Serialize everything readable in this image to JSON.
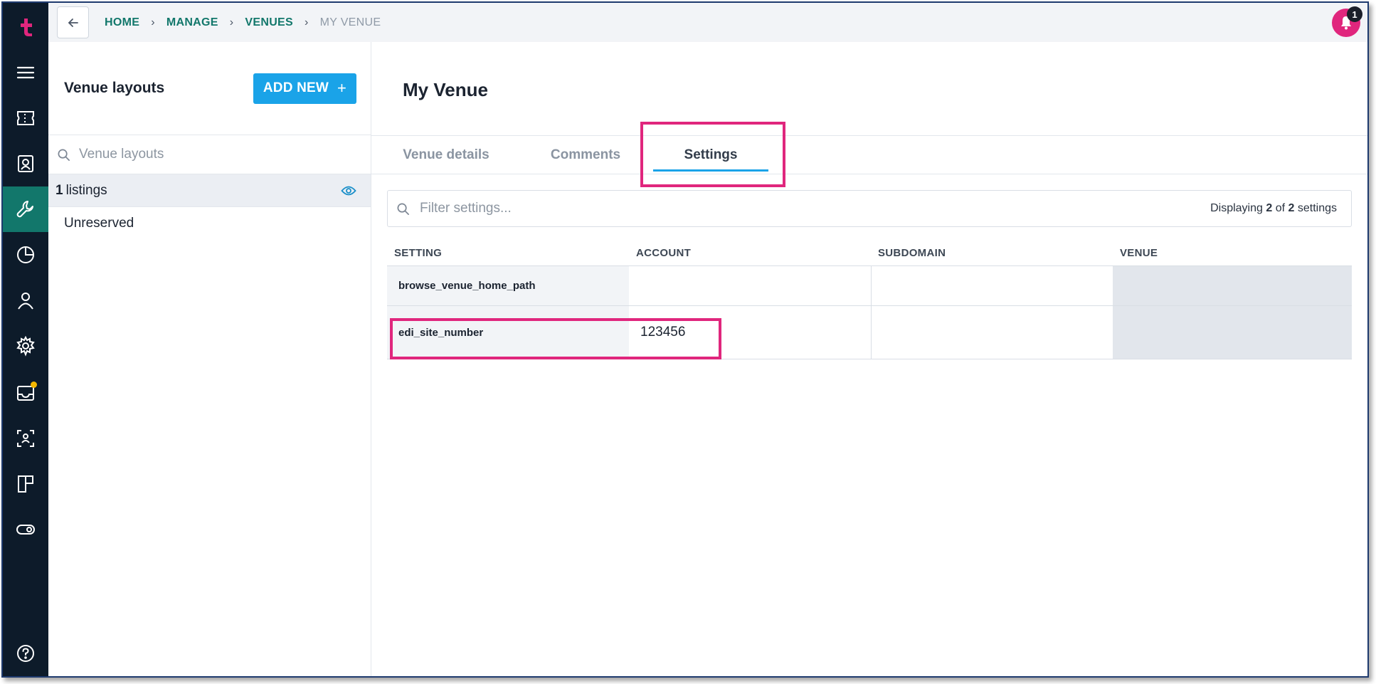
{
  "nav": {
    "items": [
      {
        "icon": "tickets-icon"
      },
      {
        "icon": "contacts-icon"
      },
      {
        "icon": "tools-icon",
        "active": true
      },
      {
        "icon": "reports-icon"
      },
      {
        "icon": "user-icon"
      },
      {
        "icon": "settings-icon"
      },
      {
        "icon": "inbox-icon"
      },
      {
        "icon": "scan-icon"
      },
      {
        "icon": "layout-icon"
      },
      {
        "icon": "toggle-icon"
      }
    ]
  },
  "breadcrumb": {
    "items": [
      "HOME",
      "MANAGE",
      "VENUES"
    ],
    "current": "MY VENUE"
  },
  "notifications": {
    "count": "1"
  },
  "left_panel": {
    "title": "Venue layouts",
    "add_button": "ADD NEW",
    "search_placeholder": "Venue layouts",
    "listings_count": "1",
    "listings_label": "listings",
    "items": [
      "Unreserved"
    ]
  },
  "main": {
    "title": "My Venue",
    "tabs": [
      "Venue details",
      "Comments",
      "Settings"
    ],
    "active_tab": "Settings",
    "filter_placeholder": "Filter settings...",
    "display": {
      "prefix": "Displaying",
      "shown": "2",
      "of": "of",
      "total": "2",
      "suffix": "settings"
    },
    "columns": [
      "SETTING",
      "ACCOUNT",
      "SUBDOMAIN",
      "VENUE"
    ],
    "rows": [
      {
        "setting": "browse_venue_home_path",
        "account": "",
        "subdomain": "",
        "venue": ""
      },
      {
        "setting": "edi_site_number",
        "account": "123456",
        "subdomain": "",
        "venue": ""
      }
    ]
  },
  "colors": {
    "rail": "#0d1b2a",
    "rail_active": "#12776b",
    "accent": "#1aa3e8",
    "brand_pink": "#e0267d",
    "breadcrumb": "#12776b"
  }
}
